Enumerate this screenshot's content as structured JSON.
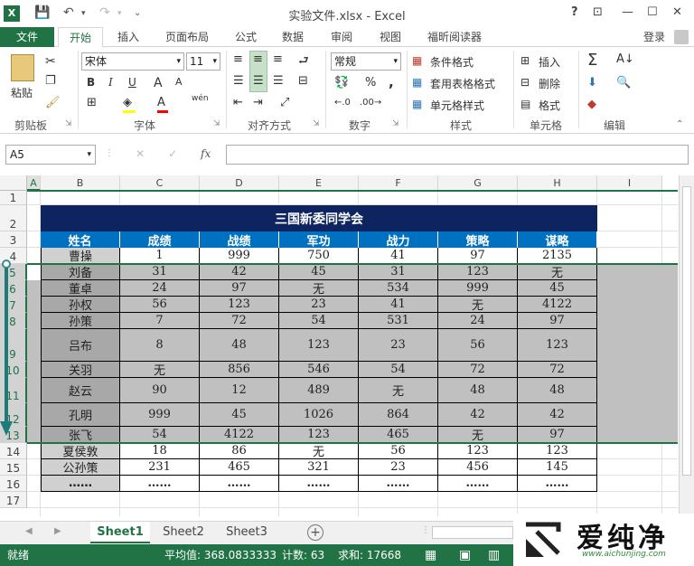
{
  "app": {
    "title": "实验文件.xlsx - Excel",
    "login": "登录",
    "help": "?",
    "window_controls": {
      "help": "?",
      "restore": "⊡",
      "minimize": "—",
      "maximize": "☐",
      "close": "✕"
    }
  },
  "tabs": [
    "文件",
    "开始",
    "插入",
    "页面布局",
    "公式",
    "数据",
    "审阅",
    "视图",
    "福昕阅读器"
  ],
  "ribbon": {
    "clipboard": {
      "label": "剪贴板",
      "paste": "粘贴"
    },
    "font": {
      "label": "字体",
      "name": "宋体",
      "size": "11",
      "bold": "B",
      "italic": "I",
      "underline": "U",
      "grow": "A",
      "wen": "wén"
    },
    "alignment": {
      "label": "对齐方式"
    },
    "number": {
      "label": "数字",
      "format": "常规",
      "percent": "%",
      "comma": ","
    },
    "styles": {
      "label": "样式",
      "conditional": "条件格式",
      "table": "套用表格格式",
      "cell_style": "单元格样式"
    },
    "cells": {
      "label": "单元格",
      "insert": "插入",
      "delete": "删除",
      "format": "格式"
    },
    "editing": {
      "label": "编辑"
    }
  },
  "formula_bar": {
    "name_box": "A5",
    "fx": "fx",
    "cancel": "✕",
    "enter": "✓"
  },
  "columns": [
    "A",
    "B",
    "C",
    "D",
    "E",
    "F",
    "G",
    "H",
    "I"
  ],
  "rows": [
    "1",
    "2",
    "3",
    "4",
    "5",
    "6",
    "7",
    "8",
    "9",
    "10",
    "11",
    "12",
    "13",
    "14",
    "15",
    "16",
    "17"
  ],
  "table": {
    "title": "三国新委同学会",
    "headers": [
      "姓名",
      "成绩",
      "战绩",
      "军功",
      "战力",
      "策略",
      "谋略"
    ],
    "data": [
      [
        "曹操",
        "1",
        "999",
        "750",
        "41",
        "97",
        "2135"
      ],
      [
        "刘备",
        "31",
        "42",
        "45",
        "31",
        "123",
        "无"
      ],
      [
        "董卓",
        "24",
        "97",
        "无",
        "534",
        "999",
        "45"
      ],
      [
        "孙权",
        "56",
        "123",
        "23",
        "41",
        "无",
        "4122"
      ],
      [
        "孙策",
        "7",
        "72",
        "54",
        "531",
        "24",
        "97"
      ],
      [
        "吕布",
        "8",
        "48",
        "123",
        "23",
        "56",
        "123"
      ],
      [
        "关羽",
        "无",
        "856",
        "546",
        "54",
        "72",
        "72"
      ],
      [
        "赵云",
        "90",
        "12",
        "489",
        "无",
        "48",
        "48"
      ],
      [
        "孔明",
        "999",
        "45",
        "1026",
        "864",
        "42",
        "42"
      ],
      [
        "张飞",
        "54",
        "4122",
        "123",
        "465",
        "无",
        "97"
      ],
      [
        "夏侯敦",
        "18",
        "86",
        "无",
        "56",
        "123",
        "123"
      ],
      [
        "公孙策",
        "231",
        "465",
        "321",
        "23",
        "456",
        "145"
      ],
      [
        "……",
        "……",
        "……",
        "……",
        "……",
        "……",
        "……"
      ]
    ]
  },
  "sheets": [
    "Sheet1",
    "Sheet2",
    "Sheet3"
  ],
  "status": {
    "ready": "就绪",
    "average": "平均值: 368.0833333",
    "count": "计数: 63",
    "sum": "求和: 17668"
  },
  "watermark": {
    "text": "爱纯净",
    "url": "www.aichunjing.com"
  },
  "colors": {
    "excel_green": "#217346",
    "header_navy": "#0d2460",
    "header_blue": "#0070c0",
    "selected_gray": "#c0c0c0"
  }
}
